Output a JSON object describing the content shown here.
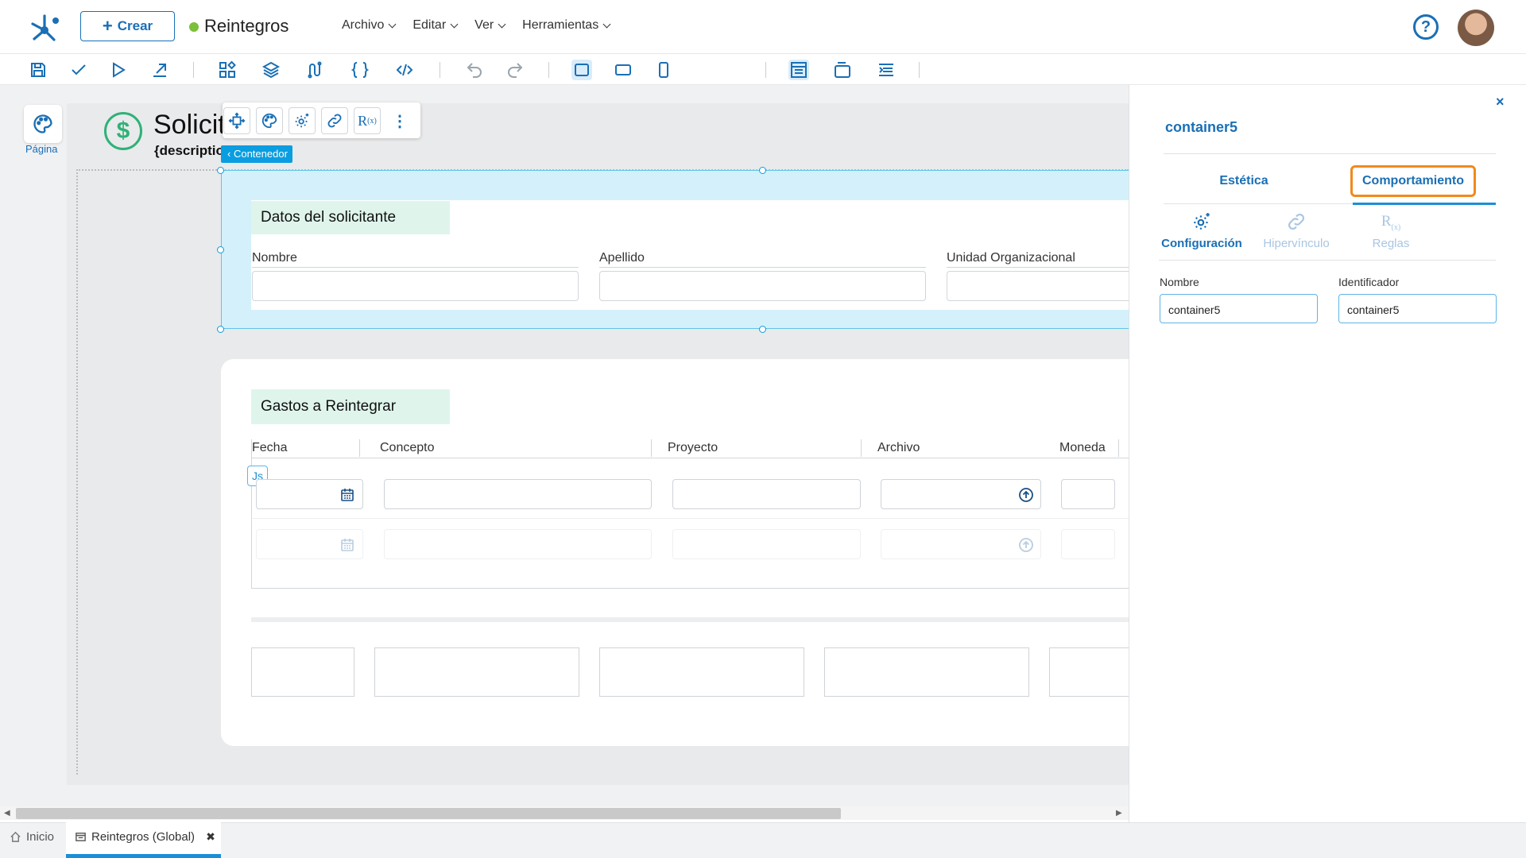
{
  "header": {
    "create_label": "Crear",
    "app_title": "Reintegros",
    "app_status_color": "#7cbf3a",
    "menu": [
      "Archivo",
      "Editar",
      "Ver",
      "Herramientas"
    ],
    "help_icon": "question-circle-icon",
    "avatar": "user-avatar"
  },
  "toolbar": {
    "width_value": "1382px",
    "icons": [
      "save-icon",
      "check-icon",
      "play-icon",
      "publish-icon",
      "components-icon",
      "layers-icon",
      "data-icon",
      "braces-icon",
      "code-icon",
      "undo-icon",
      "redo-icon",
      "desktop-view-icon",
      "tablet-view-icon",
      "mobile-view-icon",
      "layout-icon",
      "window-icon",
      "align-icon"
    ]
  },
  "sidebar_tool": {
    "label": "Página"
  },
  "form": {
    "title": "Solicitud de Reintegro",
    "description": "{description}",
    "selected_chip": "Contenedor",
    "section1": {
      "title": "Datos del solicitante",
      "fields": [
        "Nombre",
        "Apellido",
        "Unidad Organizacional"
      ]
    },
    "section2": {
      "title": "Gastos a Reintegrar",
      "columns": [
        "Fecha",
        "Concepto",
        "Proyecto",
        "Archivo",
        "Moneda"
      ],
      "js_badge": "Js"
    }
  },
  "panel": {
    "close_label": "×",
    "title": "container5",
    "tabs": [
      "Estética",
      "Comportamiento"
    ],
    "active_tab": "Comportamiento",
    "subtabs": [
      "Configuración",
      "Hipervínculo",
      "Reglas"
    ],
    "active_subtab": "Configuración",
    "fields": [
      {
        "label": "Nombre",
        "value": "container5"
      },
      {
        "label": "Identificador",
        "value": "container5"
      }
    ],
    "accent_color": "#1a6fb5",
    "highlight_color": "#f08a1c"
  },
  "bottom_tabs": [
    {
      "label": "Inicio",
      "icon": "home-icon"
    },
    {
      "label": "Reintegros (Global)",
      "icon": "form-icon",
      "close": "✖"
    }
  ]
}
